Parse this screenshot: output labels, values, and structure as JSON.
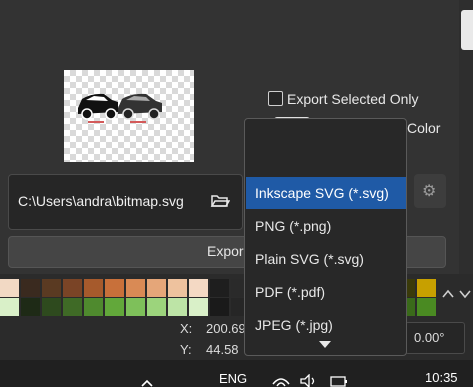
{
  "export_panel": {
    "export_selected_only_label": "Export Selected Only",
    "color_label_partial": "Color",
    "file_path": "C:\\Users\\andra\\bitmap.svg",
    "export_button_label": "Expor"
  },
  "format_dropdown": {
    "options": [
      {
        "label": "Inkscape SVG (*.svg)",
        "selected": true
      },
      {
        "label": "PNG (*.png)",
        "selected": false
      },
      {
        "label": "Plain SVG (*.svg)",
        "selected": false
      },
      {
        "label": "PDF (*.pdf)",
        "selected": false
      },
      {
        "label": "JPEG (*.jpg)",
        "selected": false
      }
    ],
    "scroll_down_icon": "triangle-down-icon"
  },
  "palette": {
    "top_row": [
      "#f2d9c4",
      "#3a2a1f",
      "#5a3a22",
      "#7a4426",
      "#a65a2c",
      "#c8703a",
      "#d98a55",
      "#e5a679",
      "#eec29e",
      "#f4d9c4",
      "#1e1e1e",
      "#2a2a2a",
      "#3a3a3a"
    ],
    "bottom_row": [
      "#d9f0c8",
      "#1e2a16",
      "#2e4a1e",
      "#3f6a26",
      "#4f8a2e",
      "#62a83a",
      "#7ec05a",
      "#9cd47c",
      "#bde4a6",
      "#d9f0c8",
      "#1a1a1a",
      "#262626",
      "#323232"
    ],
    "right_top": [
      "#3a3a0a",
      "#c7a000"
    ],
    "right_bottom": [
      "#3a6a1a",
      "#4a8a22"
    ]
  },
  "status_bar": {
    "x_label": "X:",
    "x_value": "200.69",
    "y_label": "Y:",
    "y_value": "44.58",
    "rotation_value": "0.00°"
  },
  "taskbar": {
    "language": "ENG",
    "time": "10:35"
  }
}
